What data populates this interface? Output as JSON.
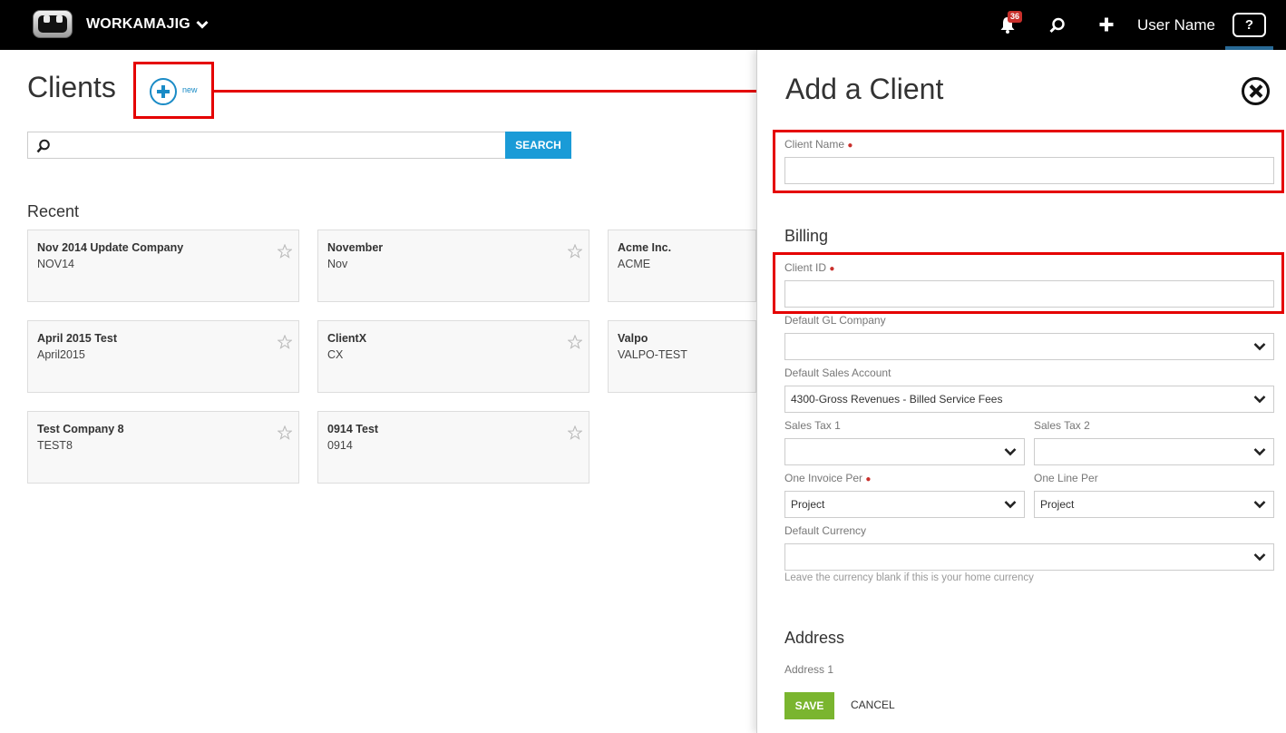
{
  "header": {
    "brand": "WORKAMAJIG",
    "notification_count": "36",
    "user_name": "User Name",
    "help_label": "?"
  },
  "clients_page": {
    "title": "Clients",
    "new_label": "new",
    "search": {
      "value": "",
      "placeholder": "",
      "button_label": "SEARCH"
    },
    "recent_title": "Recent",
    "recent_clients": [
      {
        "name": "Nov 2014 Update Company",
        "code": "NOV14"
      },
      {
        "name": "November",
        "code": "Nov"
      },
      {
        "name": "Acme Inc.",
        "code": "ACME"
      },
      {
        "name": "April 2015 Test",
        "code": "April2015"
      },
      {
        "name": "ClientX",
        "code": "CX"
      },
      {
        "name": "Valpo",
        "code": "VALPO-TEST"
      },
      {
        "name": "Test Company 8",
        "code": "TEST8"
      },
      {
        "name": "0914 Test",
        "code": "0914"
      }
    ]
  },
  "add_client_panel": {
    "title": "Add a Client",
    "client_name_label": "Client Name",
    "client_name_value": "",
    "billing_title": "Billing",
    "client_id_label": "Client ID",
    "client_id_value": "",
    "default_gl_company_label": "Default GL Company",
    "default_gl_company_value": "",
    "default_sales_account_label": "Default Sales Account",
    "default_sales_account_value": "4300-Gross Revenues - Billed Service Fees",
    "sales_tax1_label": "Sales Tax 1",
    "sales_tax1_value": "",
    "sales_tax2_label": "Sales Tax 2",
    "sales_tax2_value": "",
    "one_invoice_per_label": "One Invoice Per",
    "one_invoice_per_value": "Project",
    "one_line_per_label": "One Line Per",
    "one_line_per_value": "Project",
    "default_currency_label": "Default Currency",
    "default_currency_value": "",
    "currency_help": "Leave the currency blank if this is your home currency",
    "address_title": "Address",
    "address1_label": "Address 1",
    "save_label": "SAVE",
    "cancel_label": "CANCEL"
  },
  "colors": {
    "topbar": "#000000",
    "accent_blue": "#1a9bd7",
    "save_green": "#7ab52f",
    "highlight_red": "#e50000",
    "badge_red": "#c9302c"
  },
  "icons": [
    "logo-robot-icon",
    "chevron-down-icon",
    "bell-icon",
    "search-icon",
    "plus-icon",
    "help-icon",
    "add-circle-icon",
    "star-icon",
    "close-icon"
  ]
}
